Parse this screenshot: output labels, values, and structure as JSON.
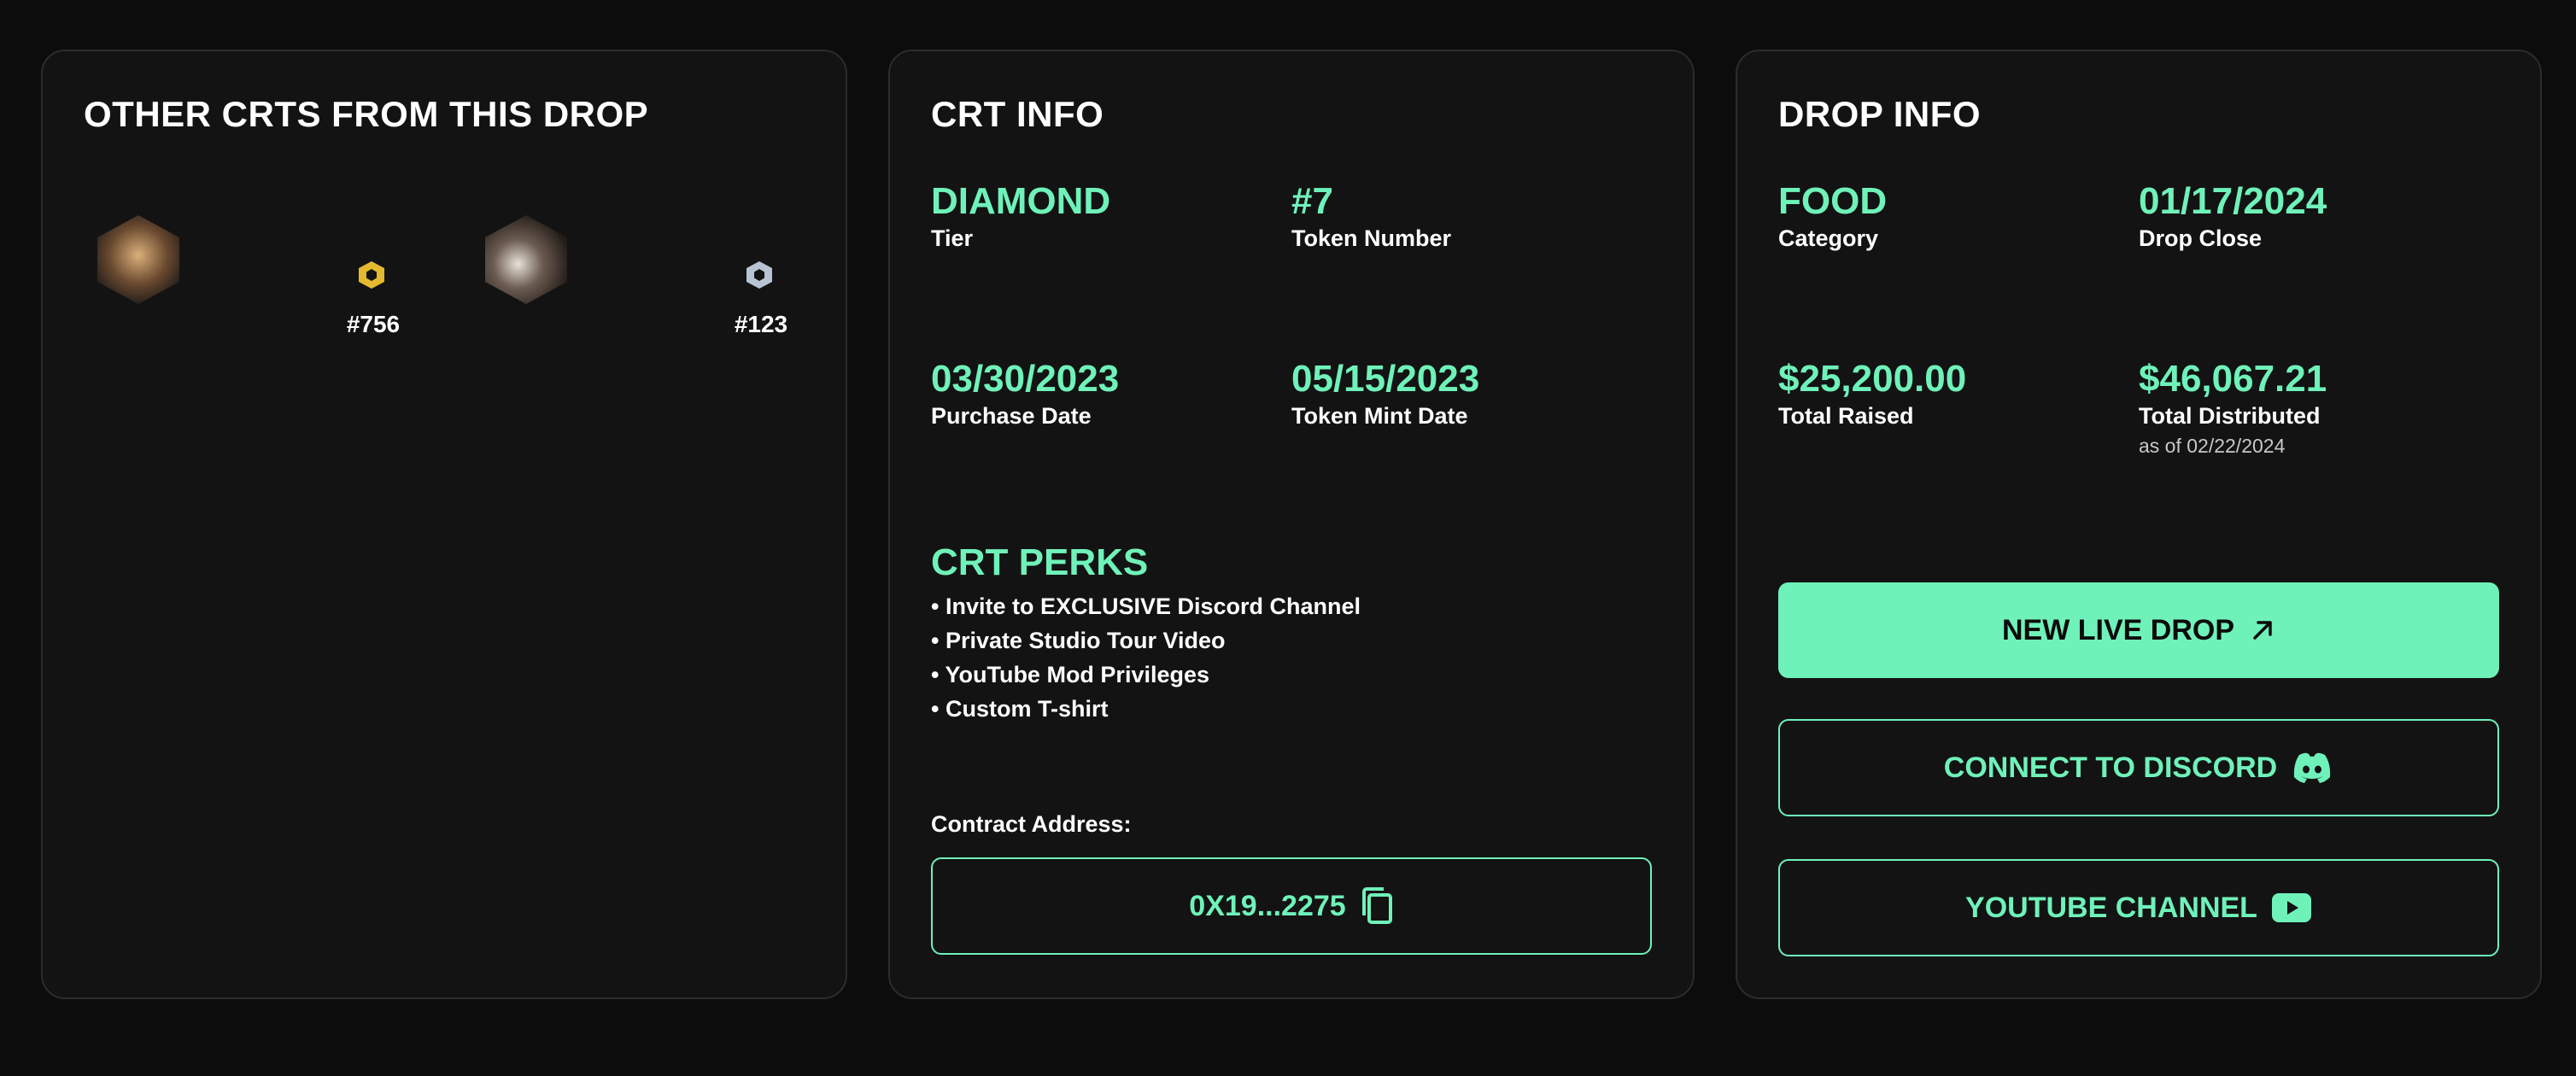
{
  "other_crts": {
    "title": "OTHER CRTS FROM THIS DROP",
    "items": [
      {
        "number": "#756",
        "tier_icon": "gold-tier-hex-icon",
        "image": "crt-thumbnail-food"
      },
      {
        "number": "#123",
        "tier_icon": "silver-tier-hex-icon",
        "image": "crt-thumbnail-food"
      }
    ]
  },
  "crt_info": {
    "title": "CRT INFO",
    "tier": {
      "value": "DIAMOND",
      "label": "Tier"
    },
    "token_number": {
      "value": "#7",
      "label": "Token Number"
    },
    "purchase_date": {
      "value": "03/30/2023",
      "label": "Purchase Date"
    },
    "mint_date": {
      "value": "05/15/2023",
      "label": "Token Mint Date"
    },
    "perks_title": "CRT PERKS",
    "perks": [
      "• Invite to EXCLUSIVE Discord Channel",
      "• Private Studio Tour Video",
      "• YouTube Mod Privileges",
      "• Custom T-shirt"
    ],
    "contract_label": "Contract Address:",
    "contract_address": "0X19...2275"
  },
  "drop_info": {
    "title": "DROP INFO",
    "category": {
      "value": "FOOD",
      "label": "Category"
    },
    "drop_close": {
      "value": "01/17/2024",
      "label": "Drop Close"
    },
    "total_raised": {
      "value": "$25,200.00",
      "label": "Total Raised"
    },
    "total_distributed": {
      "value": "$46,067.21",
      "label": "Total Distributed",
      "note": "as of 02/22/2024"
    },
    "buttons": {
      "new_live_drop": "NEW LIVE DROP",
      "connect_discord": "CONNECT TO DISCORD",
      "youtube_channel": "YOUTUBE CHANNEL"
    }
  },
  "colors": {
    "accent": "#6ff2b9",
    "background": "#0c0c0d",
    "card": "#131314",
    "gold_tier": "#e5b92f",
    "silver_tier": "#b9c4d2"
  }
}
